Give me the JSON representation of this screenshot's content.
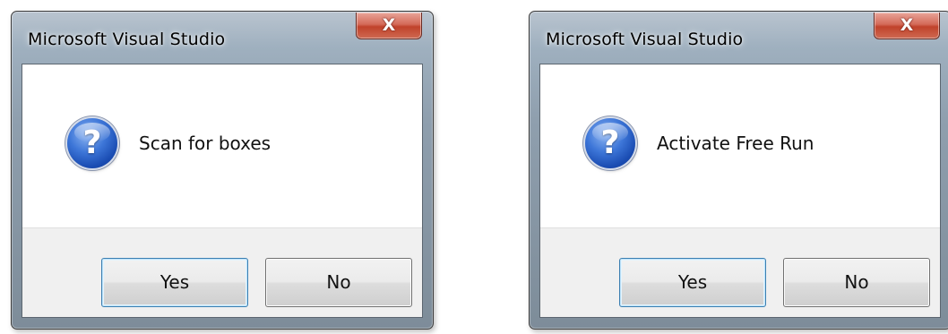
{
  "dialogs": [
    {
      "title": "Microsoft Visual Studio",
      "close_glyph": "X",
      "icon": "question-icon",
      "icon_glyph": "?",
      "message": "Scan for boxes",
      "buttons": {
        "yes": "Yes",
        "no": "No"
      }
    },
    {
      "title": "Microsoft Visual Studio",
      "close_glyph": "X",
      "icon": "question-icon",
      "icon_glyph": "?",
      "message": "Activate Free Run",
      "buttons": {
        "yes": "Yes",
        "no": "No"
      }
    }
  ],
  "colors": {
    "close_button": "#c9503a",
    "default_button_border": "#3c7fb1",
    "question_icon": "#1f55c0"
  }
}
